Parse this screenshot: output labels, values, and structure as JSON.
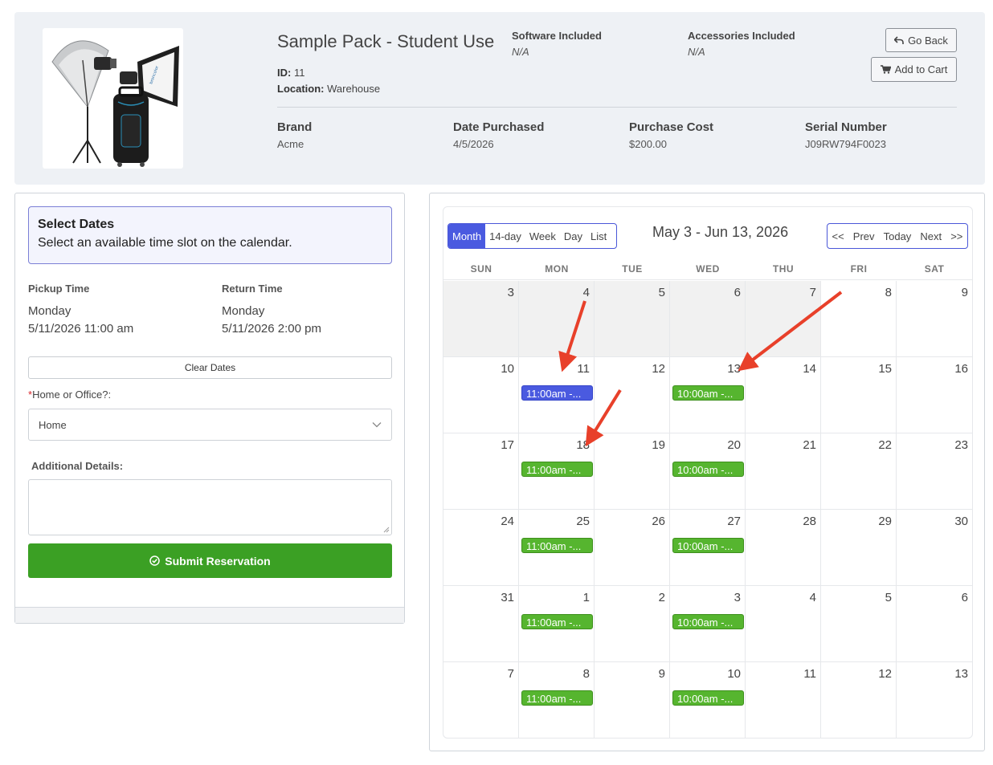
{
  "product": {
    "title": "Sample Pack - Student Use",
    "id_label": "ID:",
    "id_value": "11",
    "location_label": "Location:",
    "location_value": "Warehouse",
    "software_label": "Software Included",
    "software_value": "N/A",
    "accessories_label": "Accessories Included",
    "accessories_value": "N/A",
    "go_back_label": "Go Back",
    "add_to_cart_label": "Add to Cart",
    "brand_label": "Brand",
    "brand_value": "Acme",
    "date_label": "Date Purchased",
    "date_value": "4/5/2026",
    "cost_label": "Purchase Cost",
    "cost_value": "$200.00",
    "serial_label": "Serial Number",
    "serial_value": "J09RW794F0023",
    "image_brand_text": "broncolor"
  },
  "reservation": {
    "select_title": "Select Dates",
    "select_subtitle": "Select an available time slot on the calendar.",
    "pickup_label": "Pickup Time",
    "pickup_day": "Monday",
    "pickup_datetime": "5/11/2026 11:00 am",
    "return_label": "Return Time",
    "return_day": "Monday",
    "return_datetime": "5/11/2026 2:00 pm",
    "clear_label": "Clear Dates",
    "required_star": "*",
    "location_question": "Home or Office?:",
    "location_selected": "Home",
    "details_label": "Additional Details:",
    "submit_label": "Submit Reservation"
  },
  "calendar": {
    "views": [
      "Month",
      "14-day",
      "Week",
      "Day",
      "List"
    ],
    "active_view": "Month",
    "title": "May 3 - Jun 13, 2026",
    "nav": [
      "<<",
      "Prev",
      "Today",
      "Next",
      ">>"
    ],
    "weekdays": [
      "SUN",
      "MON",
      "TUE",
      "WED",
      "THU",
      "FRI",
      "SAT"
    ],
    "weeks": [
      [
        {
          "n": "3",
          "past": true
        },
        {
          "n": "4",
          "past": true
        },
        {
          "n": "5",
          "past": true
        },
        {
          "n": "6",
          "past": true
        },
        {
          "n": "7",
          "past": true
        },
        {
          "n": "8"
        },
        {
          "n": "9"
        }
      ],
      [
        {
          "n": "10"
        },
        {
          "n": "11",
          "ev": "11:00am -...",
          "kind": "sel"
        },
        {
          "n": "12"
        },
        {
          "n": "13",
          "ev": "10:00am -...",
          "kind": "open"
        },
        {
          "n": "14"
        },
        {
          "n": "15"
        },
        {
          "n": "16"
        }
      ],
      [
        {
          "n": "17"
        },
        {
          "n": "18",
          "ev": "11:00am -...",
          "kind": "open"
        },
        {
          "n": "19"
        },
        {
          "n": "20",
          "ev": "10:00am -...",
          "kind": "open"
        },
        {
          "n": "21"
        },
        {
          "n": "22"
        },
        {
          "n": "23"
        }
      ],
      [
        {
          "n": "24"
        },
        {
          "n": "25",
          "ev": "11:00am -...",
          "kind": "open"
        },
        {
          "n": "26"
        },
        {
          "n": "27",
          "ev": "10:00am -...",
          "kind": "open"
        },
        {
          "n": "28"
        },
        {
          "n": "29"
        },
        {
          "n": "30"
        }
      ],
      [
        {
          "n": "31"
        },
        {
          "n": "1",
          "ev": "11:00am -...",
          "kind": "open"
        },
        {
          "n": "2"
        },
        {
          "n": "3",
          "ev": "10:00am -...",
          "kind": "open"
        },
        {
          "n": "4"
        },
        {
          "n": "5"
        },
        {
          "n": "6"
        }
      ],
      [
        {
          "n": "7"
        },
        {
          "n": "8",
          "ev": "11:00am -...",
          "kind": "open"
        },
        {
          "n": "9"
        },
        {
          "n": "10",
          "ev": "10:00am -...",
          "kind": "open"
        },
        {
          "n": "11"
        },
        {
          "n": "12"
        },
        {
          "n": "13"
        }
      ]
    ]
  },
  "colors": {
    "accent_blue": "#4a5ae0",
    "available_green": "#56b52f",
    "submit_green": "#3ba024",
    "annotation_arrow": "#e8402a"
  },
  "icons": {
    "go_back": "undo-arrow-icon",
    "add_to_cart": "cart-icon",
    "submit": "check-circle-icon",
    "select_caret": "chevron-down-icon"
  }
}
